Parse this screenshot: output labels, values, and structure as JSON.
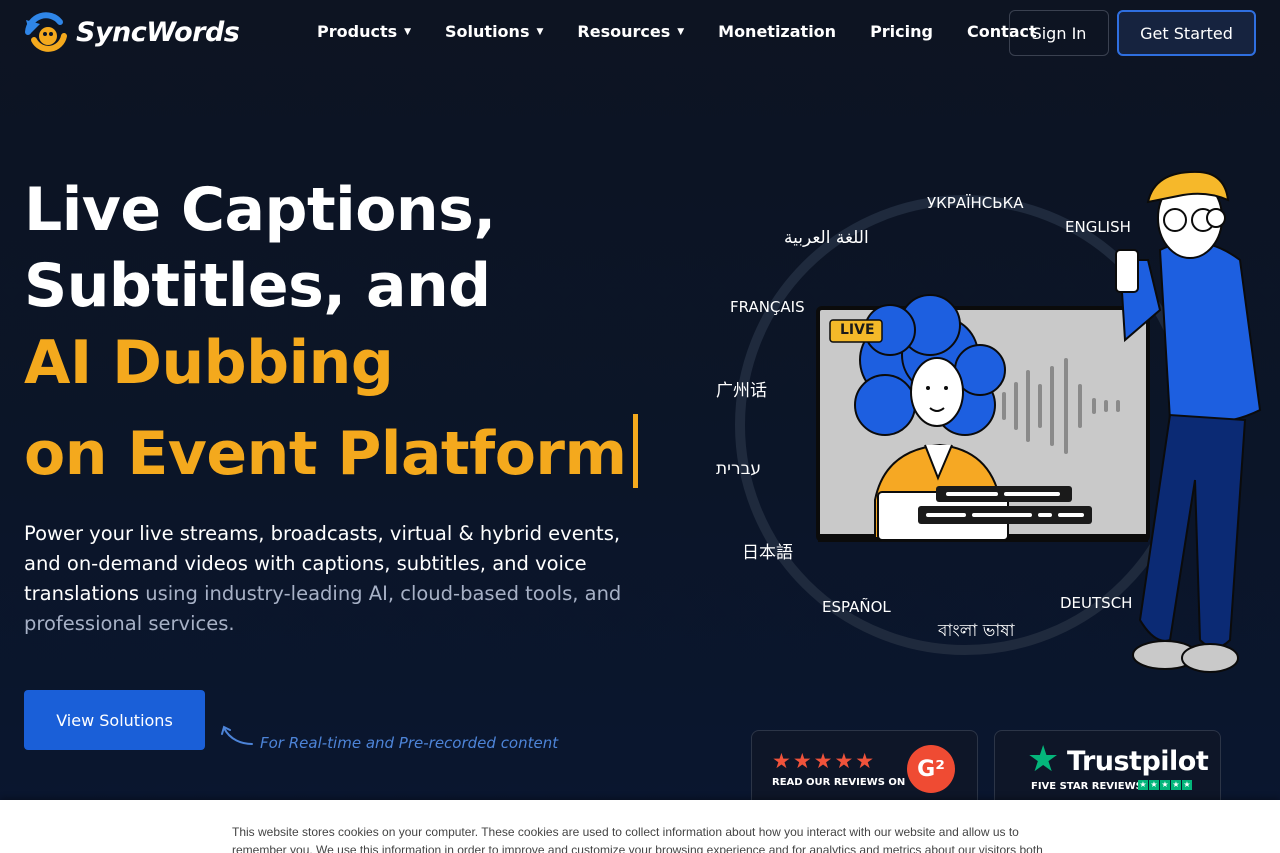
{
  "brand": {
    "name": "SyncWords"
  },
  "nav": {
    "items": [
      {
        "label": "Products",
        "dropdown": true
      },
      {
        "label": "Solutions",
        "dropdown": true
      },
      {
        "label": "Resources",
        "dropdown": true
      },
      {
        "label": "Monetization",
        "dropdown": false
      },
      {
        "label": "Pricing",
        "dropdown": false
      },
      {
        "label": "Contact",
        "dropdown": false
      }
    ],
    "signin_label": "Sign In",
    "get_started_label": "Get Started"
  },
  "hero": {
    "line1": "Live Captions,",
    "line2": "Subtitles, and",
    "line3": "AI Dubbing",
    "line4": "on Event Platform",
    "desc_main": "Power your live streams, broadcasts, virtual & hybrid events, and on-demand videos with captions, subtitles, and voice translations",
    "desc_muted": " using industry-leading AI, cloud-based tools, and professional services.",
    "cta_label": "View Solutions",
    "annotation": "For Real-time and Pre-recorded content"
  },
  "illustration": {
    "live_badge": "LIVE",
    "languages": {
      "ukrainian": "УКРАЇНСЬКА",
      "english": "ENGLISH",
      "arabic": "اللغة العربية",
      "french": "FRANÇAIS",
      "cantonese": "广州话",
      "hebrew": "עברית",
      "japanese": "日本語",
      "spanish": "ESPAÑOL",
      "bengali": "বাংলা ভাষা",
      "german": "DEUTSCH"
    }
  },
  "reviews": {
    "g2": {
      "stars": "★★★★★",
      "text": "READ OUR REVIEWS ON",
      "logo": "G²"
    },
    "trustpilot": {
      "name": "Trustpilot",
      "sub": "FIVE STAR REVIEWS",
      "star": "★"
    }
  },
  "cookie": {
    "text": "This website stores cookies on your computer. These cookies are used to collect information about how you interact with our website and allow us to remember you. We use this information in order to improve and customize your browsing experience and for analytics and metrics about our visitors both"
  },
  "colors": {
    "accent_yellow": "#f4a91d",
    "primary_blue": "#1a5fd8",
    "background": "#0b1528"
  }
}
